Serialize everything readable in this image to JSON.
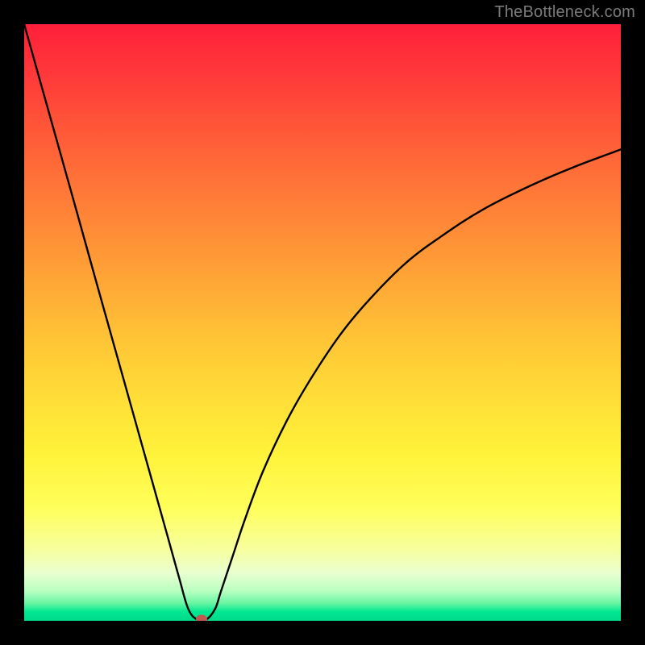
{
  "attribution": "TheBottleneck.com",
  "colors": {
    "frame": "#000000",
    "curve": "#000000",
    "marker": "#c1584f",
    "gradient_top": "#ff1f3a",
    "gradient_bottom": "#00d988"
  },
  "chart_data": {
    "type": "line",
    "title": "",
    "xlabel": "",
    "ylabel": "",
    "xlim": [
      0,
      100
    ],
    "ylim": [
      0,
      100
    ],
    "x": [
      0,
      3,
      6,
      9,
      12,
      15,
      18,
      21,
      24,
      26,
      27.5,
      29,
      30.5,
      32,
      33,
      35,
      37,
      40,
      44,
      48,
      53,
      58,
      64,
      70,
      77,
      85,
      92,
      100
    ],
    "values": [
      100,
      89.3,
      78.6,
      67.9,
      57.1,
      46.4,
      35.7,
      25.0,
      14.3,
      7.1,
      2.0,
      0.2,
      0.2,
      2.0,
      5.0,
      11.0,
      17.0,
      25.0,
      33.5,
      40.5,
      48.0,
      54.0,
      60.0,
      64.5,
      69.0,
      73.0,
      76.0,
      79.0
    ],
    "marker": {
      "x": 29.7,
      "y": 0.3
    },
    "legend": false,
    "grid": false
  }
}
